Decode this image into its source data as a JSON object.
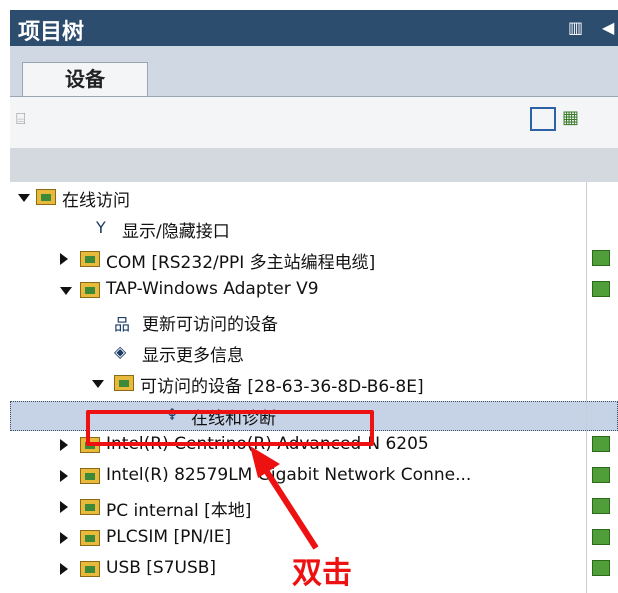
{
  "panel": {
    "title": "项目树"
  },
  "tab": {
    "label": "设备"
  },
  "toolbar": {
    "icon": "device-overview-icon"
  },
  "tree": {
    "items": [
      {
        "label": "在线访问",
        "icon": "online-access-folder-icon"
      },
      {
        "label": "显示/隐藏接口",
        "icon": "wrench-icon"
      },
      {
        "label": "COM [RS232/PPI 多主站编程电缆]",
        "icon": "folder-icon"
      },
      {
        "label": "TAP-Windows Adapter V9",
        "icon": "folder-icon"
      },
      {
        "label": "更新可访问的设备",
        "icon": "network-question-icon"
      },
      {
        "label": "显示更多信息",
        "icon": "search-network-icon"
      },
      {
        "label": "可访问的设备 [28-63-36-8D-B6-8E]",
        "icon": "folder-icon"
      },
      {
        "label": "在线和诊断",
        "icon": "diagnostics-icon"
      },
      {
        "label": "Intel(R) Centrino(R) Advanced-N 6205",
        "icon": "folder-icon"
      },
      {
        "label": "Intel(R) 82579LM Gigabit Network Conne...",
        "icon": "folder-icon"
      },
      {
        "label": "PC internal [本地]",
        "icon": "folder-icon"
      },
      {
        "label": "PLCSIM [PN/IE]",
        "icon": "folder-icon"
      },
      {
        "label": "USB [S7USB]",
        "icon": "folder-icon"
      }
    ]
  },
  "annotation": {
    "text": "双击"
  }
}
